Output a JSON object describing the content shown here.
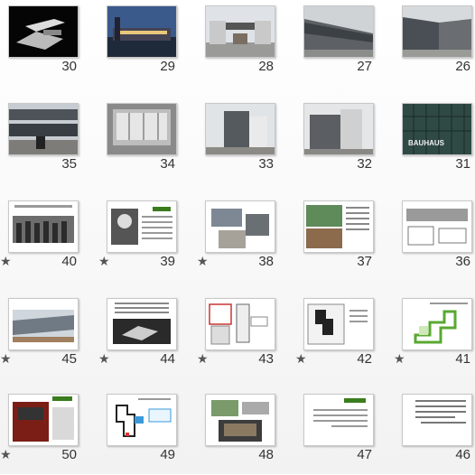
{
  "slide_sorter": {
    "rows": [
      [
        {
          "number": "30",
          "starred": false
        },
        {
          "number": "29",
          "starred": false
        },
        {
          "number": "28",
          "starred": false
        },
        {
          "number": "27",
          "starred": false
        },
        {
          "number": "26",
          "starred": false
        }
      ],
      [
        {
          "number": "35",
          "starred": false
        },
        {
          "number": "34",
          "starred": false
        },
        {
          "number": "33",
          "starred": false
        },
        {
          "number": "32",
          "starred": false
        },
        {
          "number": "31",
          "starred": false,
          "caption": "BAUHAUS"
        }
      ],
      [
        {
          "number": "40",
          "starred": true
        },
        {
          "number": "39",
          "starred": true
        },
        {
          "number": "38",
          "starred": true
        },
        {
          "number": "37",
          "starred": false
        },
        {
          "number": "36",
          "starred": false
        }
      ],
      [
        {
          "number": "45",
          "starred": true
        },
        {
          "number": "44",
          "starred": true
        },
        {
          "number": "43",
          "starred": true
        },
        {
          "number": "42",
          "starred": true
        },
        {
          "number": "41",
          "starred": true
        }
      ],
      [
        {
          "number": "50",
          "starred": true
        },
        {
          "number": "49",
          "starred": false
        },
        {
          "number": "48",
          "starred": false
        },
        {
          "number": "47",
          "starred": false
        },
        {
          "number": "46",
          "starred": false
        }
      ]
    ],
    "star_glyph": "★"
  },
  "colors": {
    "background": "#f4f4f4",
    "thumb_border": "#c8c8c8",
    "accent_green": "#3a7d1e"
  }
}
